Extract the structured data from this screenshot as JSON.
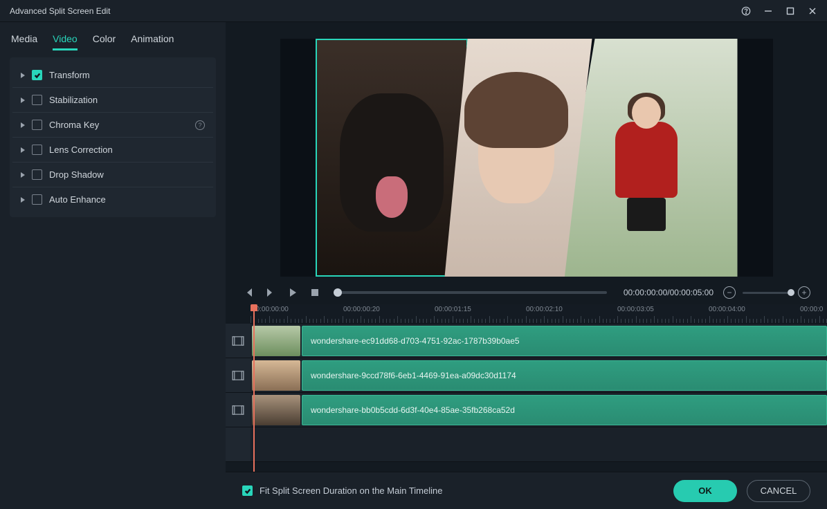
{
  "title": "Advanced Split Screen Edit",
  "tabs": [
    "Media",
    "Video",
    "Color",
    "Animation"
  ],
  "active_tab": 1,
  "props": [
    {
      "label": "Transform",
      "checked": true
    },
    {
      "label": "Stabilization",
      "checked": false
    },
    {
      "label": "Chroma Key",
      "checked": false,
      "info": true
    },
    {
      "label": "Lens Correction",
      "checked": false
    },
    {
      "label": "Drop Shadow",
      "checked": false
    },
    {
      "label": "Auto Enhance",
      "checked": false
    }
  ],
  "playback": {
    "timecode": "00:00:00:00/00:00:05:00"
  },
  "ruler": [
    "00:00:00:00",
    "00:00:00:20",
    "00:00:01:15",
    "00:00:02:10",
    "00:00:03:05",
    "00:00:04:00",
    "00:00:0"
  ],
  "clips": [
    "wondershare-ec91dd68-d703-4751-92ac-1787b39b0ae5",
    "wondershare-9ccd78f6-6eb1-4469-91ea-a09dc30d1174",
    "wondershare-bb0b5cdd-6d3f-40e4-85ae-35fb268ca52d"
  ],
  "footer": {
    "fit_label": "Fit Split Screen Duration on the Main Timeline",
    "fit_checked": true,
    "ok": "OK",
    "cancel": "CANCEL"
  }
}
